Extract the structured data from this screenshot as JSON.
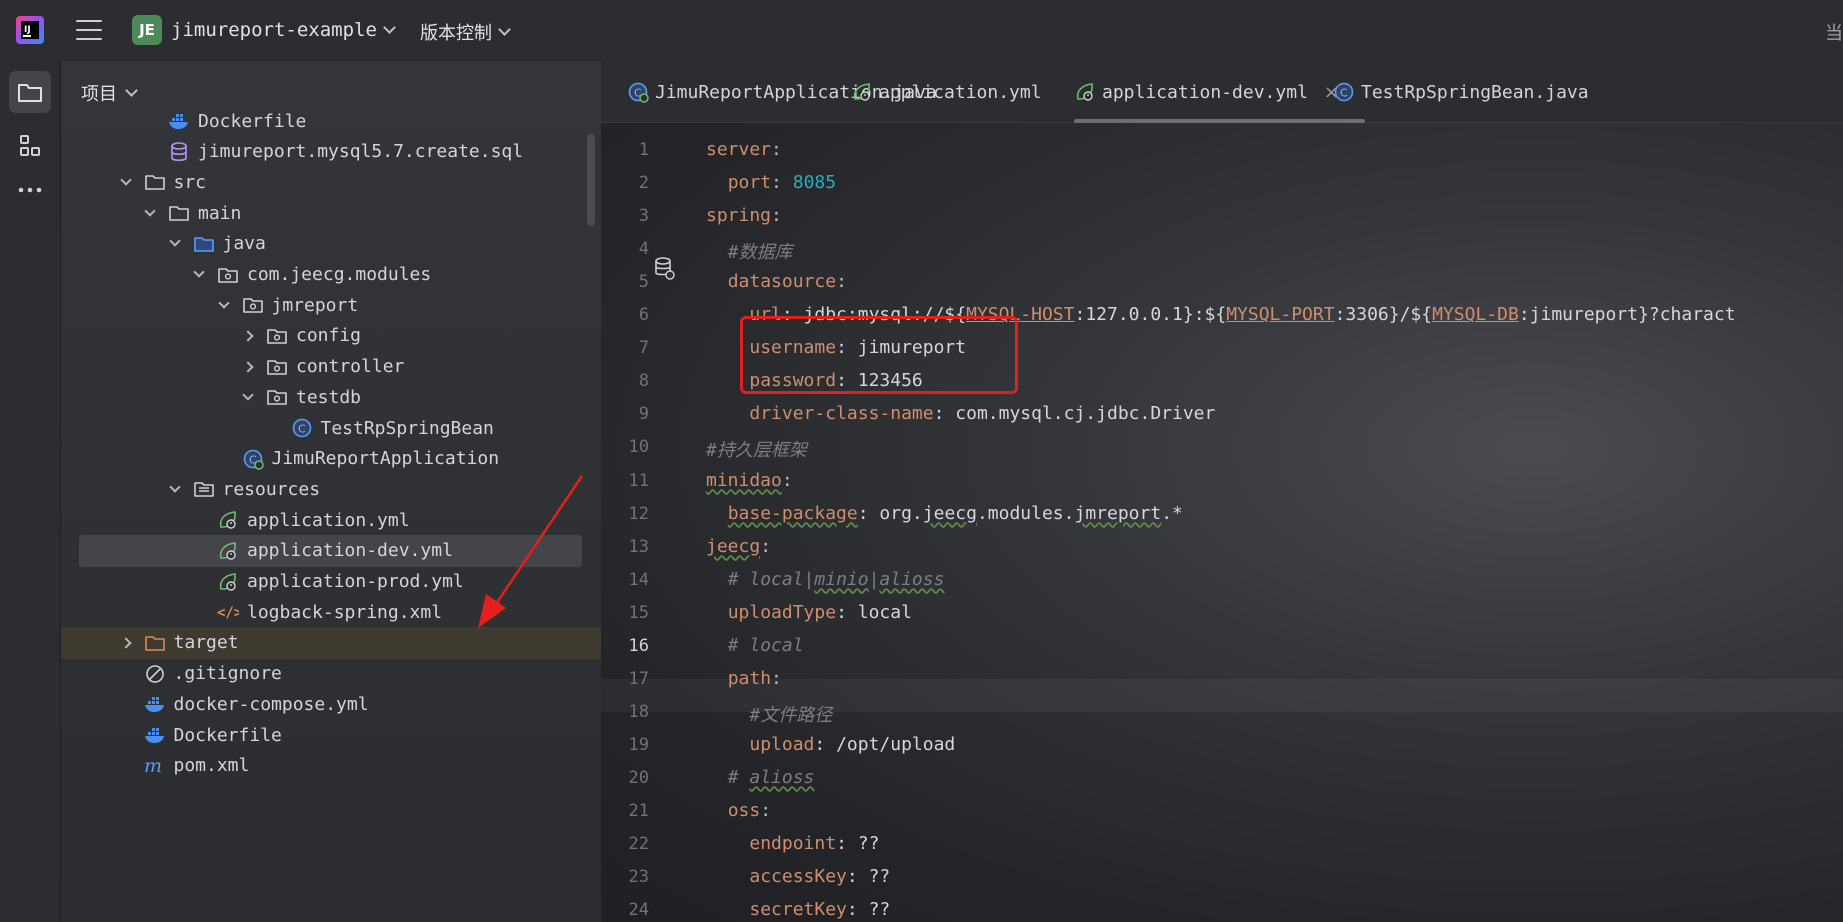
{
  "titlebar": {
    "project_badge": "JE",
    "project_name": "jimureport-example",
    "vcs_label": "版本控制",
    "right_truncated": "当"
  },
  "project_panel": {
    "title": "项目",
    "tree": [
      {
        "label": "Dockerfile",
        "icon": "docker-icon",
        "indent": 2,
        "arrow": "none"
      },
      {
        "label": "jimureport.mysql5.7.create.sql",
        "icon": "database-icon",
        "indent": 2,
        "arrow": "none"
      },
      {
        "label": "src",
        "icon": "folder-icon",
        "indent": 1,
        "arrow": "down"
      },
      {
        "label": "main",
        "icon": "folder-icon",
        "indent": 2,
        "arrow": "down"
      },
      {
        "label": "java",
        "icon": "source-folder-icon",
        "indent": 3,
        "arrow": "down"
      },
      {
        "label": "com.jeecg.modules",
        "icon": "package-icon",
        "indent": 4,
        "arrow": "down"
      },
      {
        "label": "jmreport",
        "icon": "package-icon",
        "indent": 5,
        "arrow": "down"
      },
      {
        "label": "config",
        "icon": "package-icon",
        "indent": 6,
        "arrow": "right"
      },
      {
        "label": "controller",
        "icon": "package-icon",
        "indent": 6,
        "arrow": "right"
      },
      {
        "label": "testdb",
        "icon": "package-icon",
        "indent": 6,
        "arrow": "down"
      },
      {
        "label": "TestRpSpringBean",
        "icon": "class-icon",
        "indent": 7,
        "arrow": "none"
      },
      {
        "label": "JimuReportApplication",
        "icon": "spring-class-icon",
        "indent": 5,
        "arrow": "none"
      },
      {
        "label": "resources",
        "icon": "resources-folder-icon",
        "indent": 3,
        "arrow": "down"
      },
      {
        "label": "application.yml",
        "icon": "spring-yml-icon",
        "indent": 4,
        "arrow": "none"
      },
      {
        "label": "application-dev.yml",
        "icon": "spring-yml-icon",
        "indent": 4,
        "arrow": "none",
        "selected": true
      },
      {
        "label": "application-prod.yml",
        "icon": "spring-yml-icon",
        "indent": 4,
        "arrow": "none"
      },
      {
        "label": "logback-spring.xml",
        "icon": "xml-icon",
        "indent": 4,
        "arrow": "none"
      },
      {
        "label": "target",
        "icon": "excluded-folder-icon",
        "indent": 1,
        "arrow": "right",
        "excluded": true
      },
      {
        "label": ".gitignore",
        "icon": "ignore-icon",
        "indent": 1,
        "arrow": "none"
      },
      {
        "label": "docker-compose.yml",
        "icon": "docker-icon",
        "indent": 1,
        "arrow": "none"
      },
      {
        "label": "Dockerfile",
        "icon": "docker-icon",
        "indent": 1,
        "arrow": "none"
      },
      {
        "label": "pom.xml",
        "icon": "maven-icon",
        "indent": 1,
        "arrow": "none"
      }
    ]
  },
  "tabs": [
    {
      "label": "JimuReportApplication.java",
      "icon": "spring-class-icon"
    },
    {
      "label": "application.yml",
      "icon": "spring-yml-icon"
    },
    {
      "label": "application-dev.yml",
      "icon": "spring-yml-icon",
      "active": true,
      "close": "×"
    },
    {
      "label": "TestRpSpringBean.java",
      "icon": "class-icon"
    }
  ],
  "editor": {
    "current_line": 16,
    "lines": [
      [
        {
          "t": "server",
          "c": "k"
        },
        {
          "t": ":",
          "c": ""
        }
      ],
      [
        {
          "t": "  ",
          "c": ""
        },
        {
          "t": "port",
          "c": "k"
        },
        {
          "t": ": ",
          "c": ""
        },
        {
          "t": "8085",
          "c": "n"
        }
      ],
      [
        {
          "t": "spring",
          "c": "k"
        },
        {
          "t": ":",
          "c": ""
        }
      ],
      [
        {
          "t": "  ",
          "c": ""
        },
        {
          "t": "#数据库",
          "c": "c"
        }
      ],
      [
        {
          "t": "  ",
          "c": ""
        },
        {
          "t": "datasource",
          "c": "k"
        },
        {
          "t": ":",
          "c": ""
        }
      ],
      [
        {
          "t": "    ",
          "c": ""
        },
        {
          "t": "url",
          "c": "k"
        },
        {
          "t": ": jdbc:mysql://${",
          "c": "v"
        },
        {
          "t": "MYSQL-HOST",
          "c": "err"
        },
        {
          "t": ":127.0.0.1}:${",
          "c": "v"
        },
        {
          "t": "MYSQL-PORT",
          "c": "err"
        },
        {
          "t": ":3306}/${",
          "c": "v"
        },
        {
          "t": "MYSQL-DB",
          "c": "err"
        },
        {
          "t": ":jimureport}?charact",
          "c": "v"
        }
      ],
      [
        {
          "t": "    ",
          "c": ""
        },
        {
          "t": "username",
          "c": "k"
        },
        {
          "t": ": jimureport",
          "c": "v"
        }
      ],
      [
        {
          "t": "    ",
          "c": ""
        },
        {
          "t": "password",
          "c": "k"
        },
        {
          "t": ": 123456",
          "c": "v"
        }
      ],
      [
        {
          "t": "    ",
          "c": ""
        },
        {
          "t": "driver-class-name",
          "c": "k"
        },
        {
          "t": ": com.mysql.cj.jdbc.Driver",
          "c": "v"
        }
      ],
      [
        {
          "t": "#持久层框架",
          "c": "c"
        }
      ],
      [
        {
          "t": "minidao",
          "c": "k spell"
        },
        {
          "t": ":",
          "c": ""
        }
      ],
      [
        {
          "t": "  ",
          "c": ""
        },
        {
          "t": "base-package",
          "c": "k spell"
        },
        {
          "t": ": org.",
          "c": "v"
        },
        {
          "t": "jeecg",
          "c": "v spell"
        },
        {
          "t": ".modules.",
          "c": "v"
        },
        {
          "t": "jmreport",
          "c": "v spell"
        },
        {
          "t": ".*",
          "c": "v"
        }
      ],
      [
        {
          "t": "jeecg",
          "c": "k spell"
        },
        {
          "t": ":",
          "c": ""
        }
      ],
      [
        {
          "t": "  ",
          "c": ""
        },
        {
          "t": "# local|",
          "c": "c"
        },
        {
          "t": "minio",
          "c": "c spell"
        },
        {
          "t": "|",
          "c": "c"
        },
        {
          "t": "alioss",
          "c": "c spell"
        }
      ],
      [
        {
          "t": "  ",
          "c": ""
        },
        {
          "t": "uploadType",
          "c": "k"
        },
        {
          "t": ": local",
          "c": "v"
        }
      ],
      [
        {
          "t": "  ",
          "c": ""
        },
        {
          "t": "# local",
          "c": "c"
        }
      ],
      [
        {
          "t": "  ",
          "c": ""
        },
        {
          "t": "path",
          "c": "k"
        },
        {
          "t": ":",
          "c": ""
        }
      ],
      [
        {
          "t": "    ",
          "c": ""
        },
        {
          "t": "#文件路径",
          "c": "c"
        }
      ],
      [
        {
          "t": "    ",
          "c": ""
        },
        {
          "t": "upload",
          "c": "k"
        },
        {
          "t": ": /opt/upload",
          "c": "v"
        }
      ],
      [
        {
          "t": "  ",
          "c": ""
        },
        {
          "t": "# ",
          "c": "c"
        },
        {
          "t": "alioss",
          "c": "c spell"
        }
      ],
      [
        {
          "t": "  ",
          "c": ""
        },
        {
          "t": "oss",
          "c": "k"
        },
        {
          "t": ":",
          "c": ""
        }
      ],
      [
        {
          "t": "    ",
          "c": ""
        },
        {
          "t": "endpoint",
          "c": "k"
        },
        {
          "t": ": ??",
          "c": "v"
        }
      ],
      [
        {
          "t": "    ",
          "c": ""
        },
        {
          "t": "accessKey",
          "c": "k"
        },
        {
          "t": ": ??",
          "c": "v"
        }
      ],
      [
        {
          "t": "    ",
          "c": ""
        },
        {
          "t": "secretKey",
          "c": "k"
        },
        {
          "t": ": ??",
          "c": "v"
        }
      ]
    ]
  },
  "colors": {
    "keyword": "#cf8e6d",
    "number": "#2aacb8",
    "comment": "#7a7e85",
    "annotation_red": "#e3201b"
  }
}
